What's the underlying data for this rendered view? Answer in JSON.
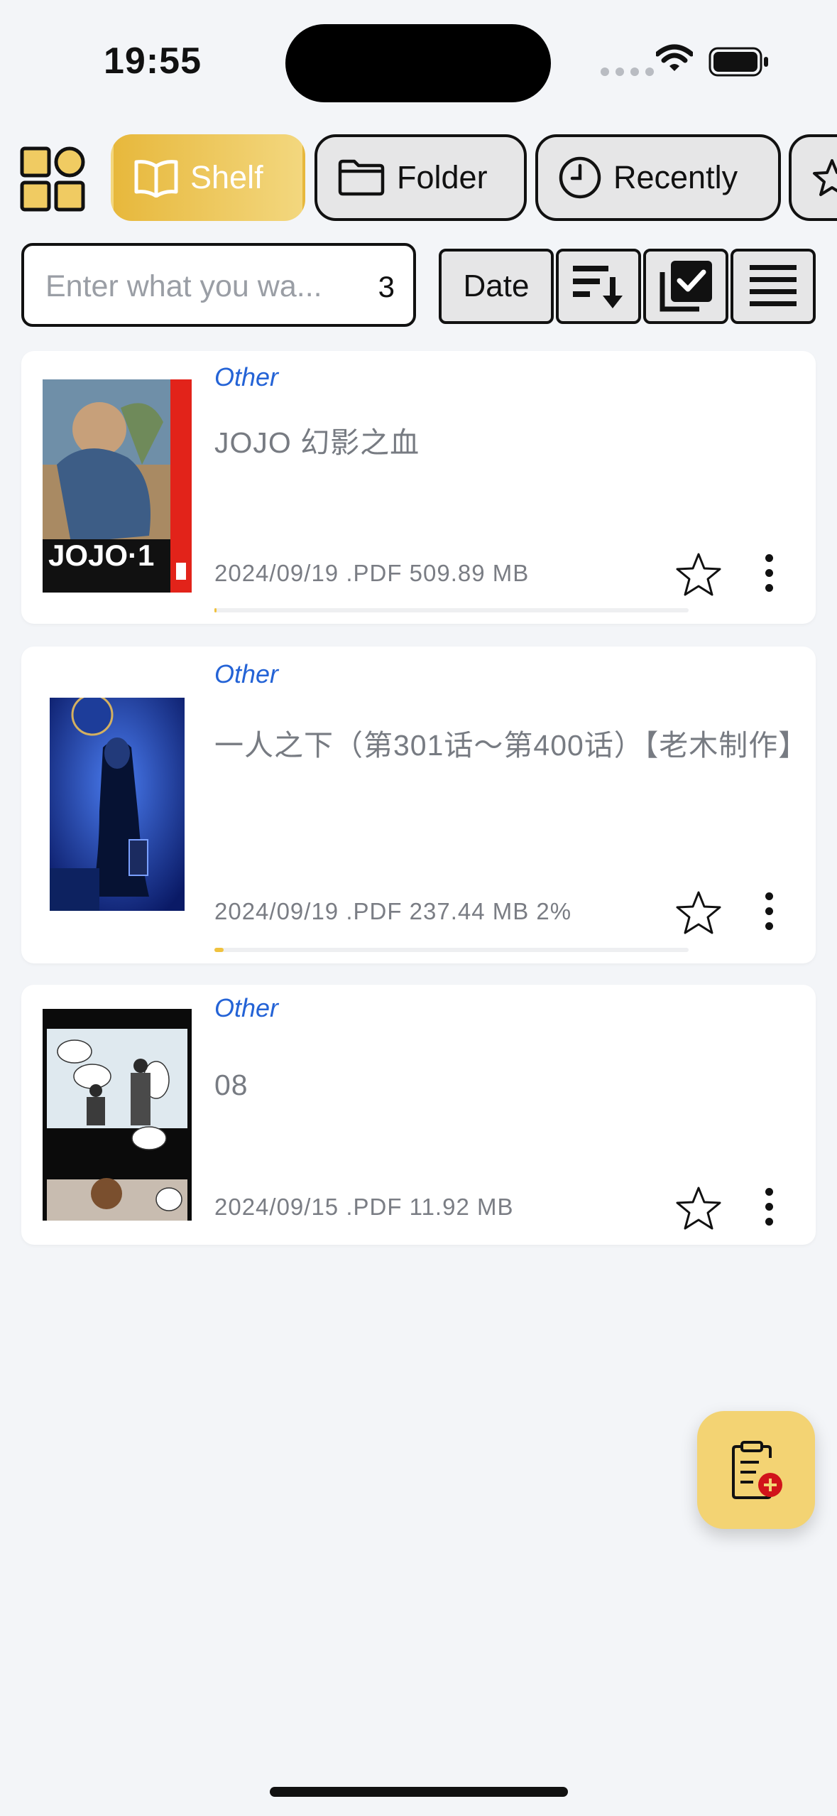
{
  "status_bar": {
    "time": "19:55"
  },
  "tabs": [
    {
      "label": "Shelf",
      "icon": "book-icon",
      "active": true
    },
    {
      "label": "Folder",
      "icon": "folder-icon",
      "active": false
    },
    {
      "label": "Recently",
      "icon": "clock-icon",
      "active": false
    },
    {
      "label": "",
      "icon": "star-icon",
      "active": false
    }
  ],
  "search": {
    "placeholder": "Enter what you wa...",
    "value": "",
    "count": "3"
  },
  "toolbar": {
    "sort_field": "Date"
  },
  "books": [
    {
      "category": "Other",
      "title": "JOJO 幻影之血",
      "meta": "2024/09/19 .PDF 509.89 MB",
      "progress": 0.005,
      "favorite": false
    },
    {
      "category": "Other",
      "title": "一人之下（第301话～第400话）【老木制作】",
      "meta": "2024/09/19 .PDF 237.44 MB 2%",
      "progress": 0.02,
      "favorite": false
    },
    {
      "category": "Other",
      "title": "08",
      "meta": "2024/09/15 .PDF 11.92 MB",
      "progress": null,
      "favorite": false
    }
  ],
  "fab": {
    "icon": "add-document-icon"
  },
  "colors": {
    "accent": "#f0c23f",
    "category": "#2463d6",
    "background": "#f3f5f8"
  }
}
